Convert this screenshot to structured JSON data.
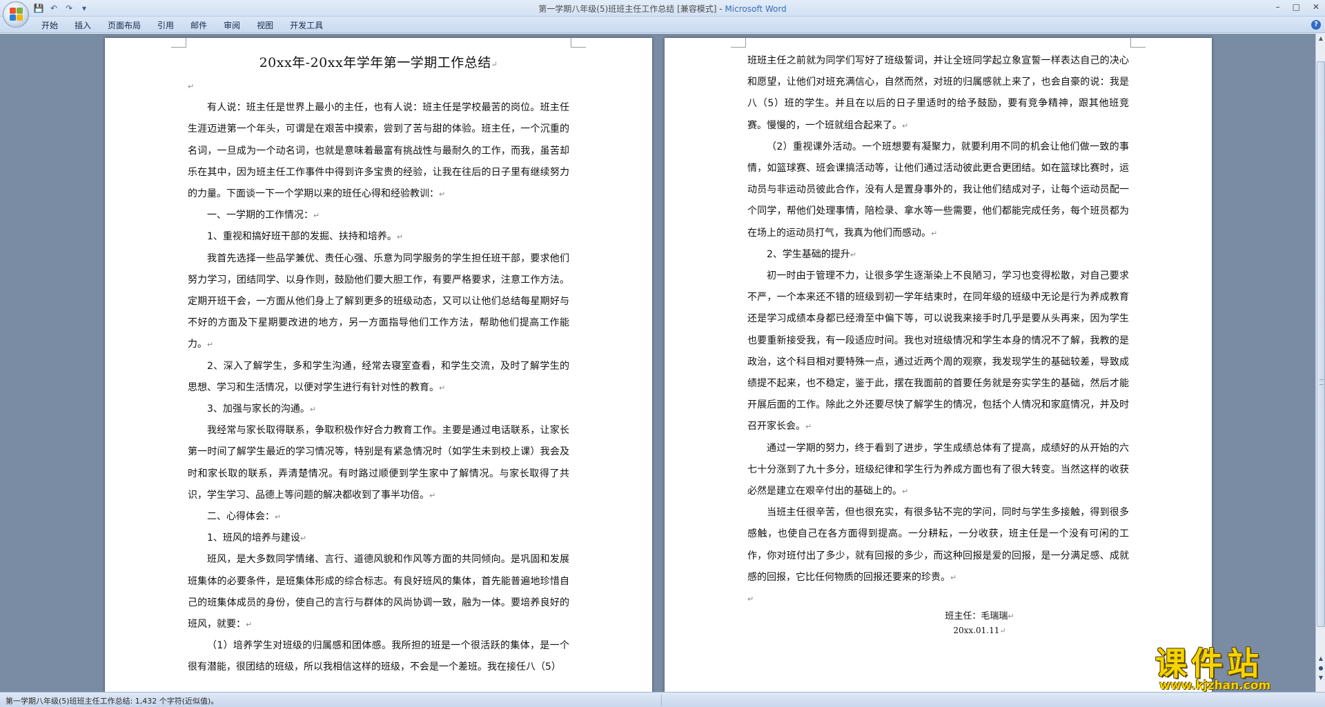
{
  "window": {
    "title": "第一学期八年级(5)班班主任工作总结 [兼容模式] - ",
    "app_name": "Microsoft Word",
    "controls": [
      "–",
      "□",
      "✕"
    ]
  },
  "ribbon": {
    "tabs": [
      "开始",
      "插入",
      "页面布局",
      "引用",
      "邮件",
      "审阅",
      "视图",
      "开发工具"
    ],
    "help": "?"
  },
  "qat": {
    "save": "💾",
    "undo": "↶",
    "redo": "↷",
    "more": "▾"
  },
  "page1": {
    "title": "20xx年-20xx年学年第一学期工作总结",
    "paragraphs": [
      {
        "text": "",
        "indent": false
      },
      {
        "text": "有人说：班主任是世界上最小的主任，也有人说：班主任是学校最苦的岗位。班主任生涯迈进第一个年头，可谓是在艰苦中摸索，尝到了苦与甜的体验。班主任，一个沉重的名词，一旦成为一个动名词，也就是意味着最富有挑战性与最耐久的工作，而我，虽苦却乐在其中，因为班主任工作事件中得到许多宝贵的经验，让我在往后的日子里有继续努力的力量。下面谈一下一个学期以来的班任心得和经验教训：",
        "indent": true
      },
      {
        "text": " 一、一学期的工作情况：",
        "indent": true
      },
      {
        "text": " 1、重视和搞好班干部的发掘、扶持和培养。",
        "indent": true
      },
      {
        "text": " 我首先选择一些品学兼优、责任心强、乐意为同学服务的学生担任班干部，要求他们努力学习，团结同学、以身作则，鼓励他们要大胆工作，有要严格要求，注意工作方法。定期开班干会，一方面从他们身上了解到更多的班级动态，又可以让他们总结每星期好与不好的方面及下星期要改进的地方，另一方面指导他们工作方法，帮助他们提高工作能力。",
        "indent": true
      },
      {
        "text": "2、深入了解学生，多和学生沟通，经常去寝室查看，和学生交流，及时了解学生的思想、学习和生活情况，以便对学生进行有针对性的教育。",
        "indent": true
      },
      {
        "text": "3、加强与家长的沟通。",
        "indent": true
      },
      {
        "text": "我经常与家长取得联系，争取积极作好合力教育工作。主要是通过电话联系，让家长第一时间了解学生最近的学习情况等，特别是有紧急情况时（如学生未到校上课）我会及时和家长取的联系，弄清楚情况。有时路过顺便到学生家中了解情况。与家长取得了共识，学生学习、品德上等问题的解决都收到了事半功倍。",
        "indent": true
      },
      {
        "text": "二、心得体会：",
        "indent": true
      },
      {
        "text": "1、班风的培养与建设",
        "indent": true
      },
      {
        "text": "班风，是大多数同学情绪、言行、道德风貌和作风等方面的共同倾向。是巩固和发展班集体的必要条件，是班集体形成的综合标志。有良好班风的集体，首先能普遍地珍惜自己的班集体成员的身份，使自己的言行与群体的风尚协调一致，融为一体。要培养良好的班风，就要：",
        "indent": true
      },
      {
        "text": " （1）培养学生对班级的归属感和团体感。我所担的班是一个很活跃的集体，是一个很有潜能，很团结的班级，所以我相信这样的班级，不会是一个差班。我在接任八（5）",
        "indent": true,
        "nomark": true
      }
    ]
  },
  "page2": {
    "paragraphs": [
      {
        "text": "班班主任之前就为同学们写好了班级誓词，并让全班同学起立象宣誓一样表达自己的决心和愿望，让他们对班充满信心，自然而然，对班的归属感就上来了，也会自豪的说：我是八（5）班的学生。并且在以后的日子里适时的给予鼓励，要有竞争精神，跟其他班竞赛。慢慢的，一个班就组合起来了。",
        "indent": false
      },
      {
        "text": "（2）重视课外活动。一个班想要有凝聚力，就要利用不同的机会让他们做一致的事情，如篮球赛、班会课搞活动等，让他们通过活动彼此更合更团结。如在篮球比赛时，运动员与非运动员彼此合作，没有人是置身事外的，我让他们结成对子，让每个运动员配一个同学，帮他们处理事情，陪检录、拿水等一些需要，他们都能完成任务，每个班员都为在场上的运动员打气，我真为他们而感动。",
        "indent": true
      },
      {
        "text": "2、学生基础的提升",
        "indent": true
      },
      {
        "text": "初一时由于管理不力，让很多学生逐渐染上不良陋习，学习也变得松散，对自己要求不严，一个本来还不错的班级到初一学年结束时，在同年级的班级中无论是行为养成教育还是学习成绩本身都已经滑至中偏下等，可以说我来接手时几乎是要从头再来，因为学生也要重新接受我，有一段适应时间。我也对班级情况和学生本身的情况不了解，我教的是政治，这个科目相对要特殊一点，通过近两个周的观察，我发现学生的基础较差，导致成绩提不起来，也不稳定，鉴于此，摆在我面前的首要任务就是夯实学生的基础，然后才能开展后面的工作。除此之外还要尽快了解学生的情况，包括个人情况和家庭情况，并及时召开家长会。",
        "indent": true
      },
      {
        "text": "通过一学期的努力，终于看到了进步，学生成绩总体有了提高，成绩好的从开始的六七十分涨到了九十多分，班级纪律和学生行为养成方面也有了很大转变。当然这样的收获必然是建立在艰辛付出的基础上的。",
        "indent": true
      },
      {
        "text": "当班主任很辛苦，但也很充实，有很多钻不完的学问，同时与学生多接触，得到很多感触，也使自己在各方面得到提高。一分耕耘，一分收获，班主任是一个没有可闲的工作，你对班付出了多少，就有回报的多少，而这种回报是爱的回报，是一分满足感、成就感的回报，它比任何物质的回报还要来的珍贵。",
        "indent": true
      },
      {
        "text": "",
        "indent": false
      }
    ],
    "signature": "班主任：毛瑞瑞",
    "date": "20xx.01.11"
  },
  "paragraph_mark": "↵",
  "statusbar": {
    "text": "第一学期八年级(5)班班主任工作总结: 1,432 个字符(近似值)。"
  },
  "watermark": {
    "main": "课件站",
    "url": "www.kjzhan.com"
  },
  "colors": {
    "accent": "#3a6db4",
    "page_bg": "#ffffff",
    "workspace": "#7a8ba4",
    "watermark": "#f5d400"
  }
}
